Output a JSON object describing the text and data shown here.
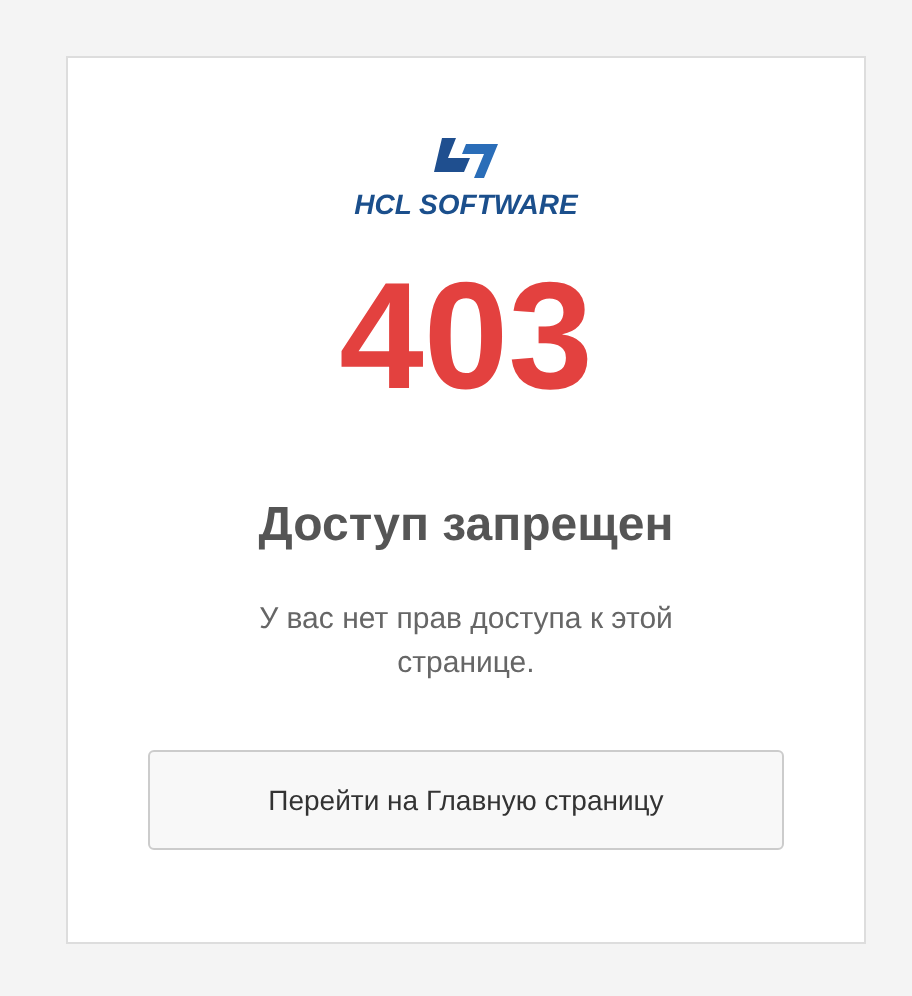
{
  "logo": {
    "text": "HCL SOFTWARE"
  },
  "code": "403",
  "title": "Доступ запрещен",
  "message": "У вас нет прав доступа к этой странице.",
  "button": {
    "label": "Перейти на Главную страницу"
  }
}
